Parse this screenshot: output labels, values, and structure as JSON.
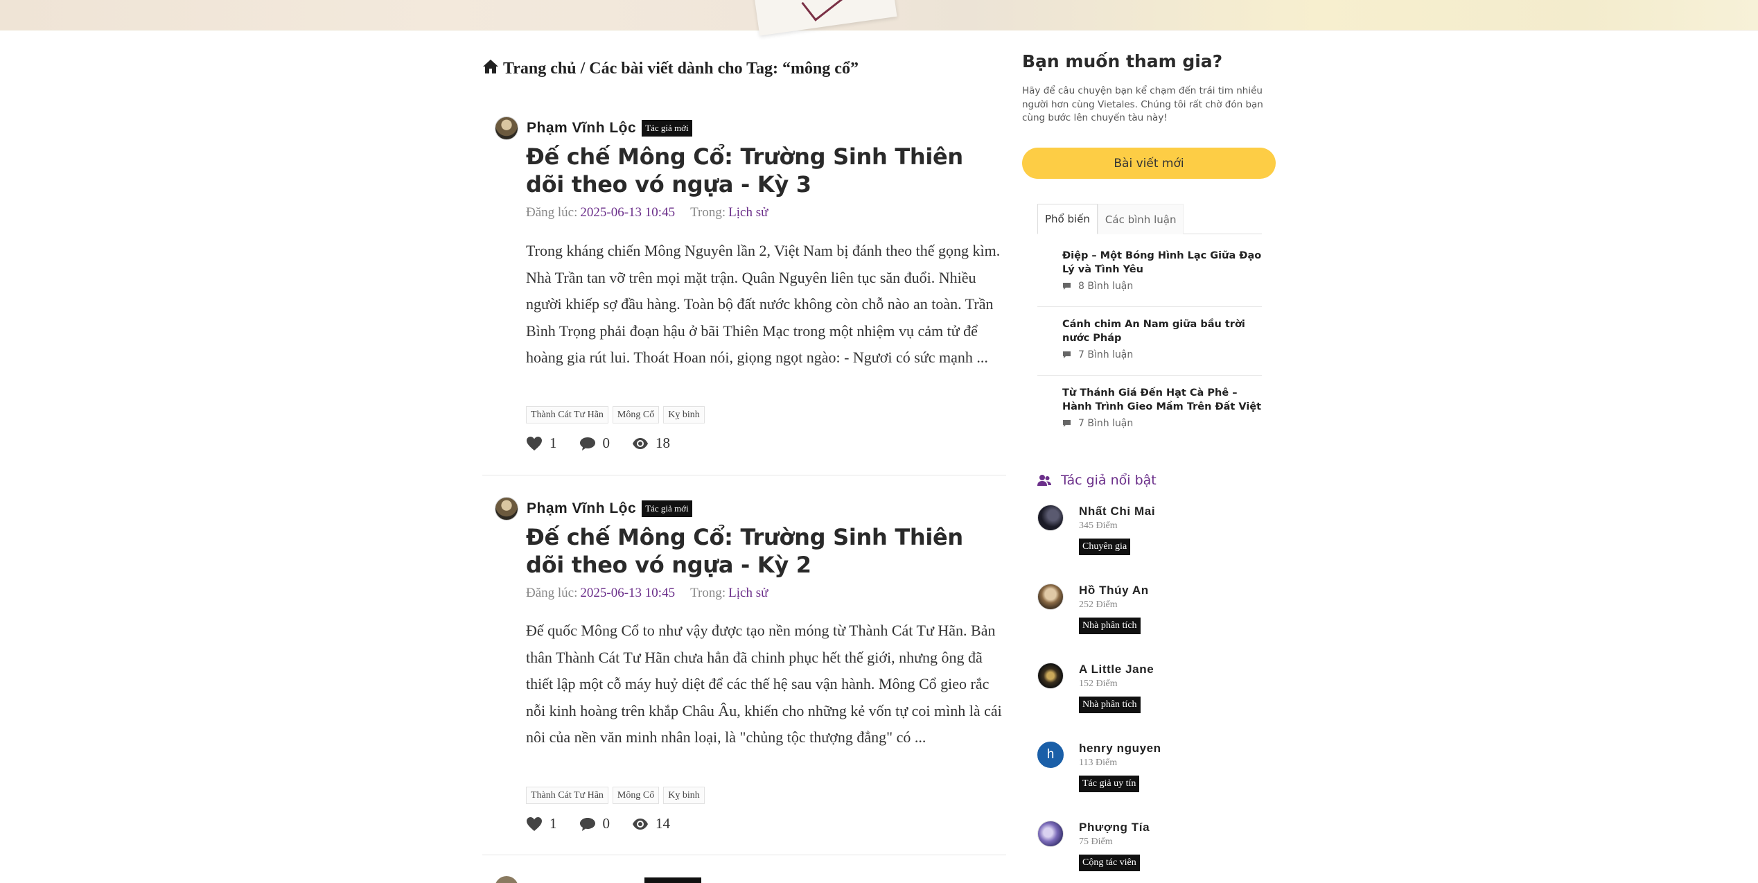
{
  "breadcrumb": {
    "home": "Trang chủ",
    "separator": "/",
    "current": "Các bài viết dành cho Tag: “mông cổ”"
  },
  "posts": [
    {
      "author": "Phạm Vĩnh Lộc",
      "author_badge": "Tác giả mới",
      "title": "Đế chế Mông Cổ: Trường Sinh Thiên dõi theo vó ngựa - Kỳ 3",
      "posted_label": "Đăng lúc:",
      "posted_at": "2025-06-13 10:45",
      "in_label": "Trong:",
      "category": "Lịch sử",
      "excerpt": "Trong kháng chiến Mông Nguyên lần 2, Việt Nam bị đánh theo thế gọng kìm. Nhà Trần tan vỡ trên mọi mặt trận. Quân Nguyên liên tục săn đuổi. Nhiều người khiếp sợ đầu hàng. Toàn bộ đất nước không còn chỗ nào an toàn. Trần Bình Trọng phải đoạn hậu ở bãi Thiên Mạc trong một nhiệm vụ cảm tử để hoàng gia rút lui. Thoát Hoan nói, giọng ngọt ngào: - Ngươi có sức mạnh ...",
      "tags": [
        "Thành Cát Tư Hãn",
        "Mông Cổ",
        "Kỵ binh"
      ],
      "likes": "1",
      "comments": "0",
      "views": "18"
    },
    {
      "author": "Phạm Vĩnh Lộc",
      "author_badge": "Tác giả mới",
      "title": "Đế chế Mông Cổ: Trường Sinh Thiên dõi theo vó ngựa - Kỳ 2",
      "posted_label": "Đăng lúc:",
      "posted_at": "2025-06-13 10:45",
      "in_label": "Trong:",
      "category": "Lịch sử",
      "excerpt": "Đế quốc Mông Cổ to như vậy được tạo nền móng từ Thành Cát Tư Hãn. Bản thân Thành Cát Tư Hãn chưa hẳn đã chinh phục hết thế giới, nhưng ông đã thiết lập một cỗ máy huỷ diệt để các thế hệ sau vận hành.  Mông Cổ gieo rắc nỗi kinh hoàng trên khắp Châu Âu, khiến cho những kẻ vốn tự coi mình là cái nôi của nền văn minh nhân loại, là \"chủng tộc thượng đẳng\" có ...",
      "tags": [
        "Thành Cát Tư Hãn",
        "Mông Cổ",
        "Kỵ binh"
      ],
      "likes": "1",
      "comments": "0",
      "views": "14"
    }
  ],
  "sidebar": {
    "join_title": "Bạn muốn tham gia?",
    "join_desc": "Hãy để câu chuyện bạn kể chạm đến trái tim nhiều người hơn cùng Vietales. Chúng tôi rất chờ đón bạn cùng bước lên chuyến tàu này!",
    "new_post_button": "Bài viết mới",
    "tabs": [
      "Phổ biến",
      "Các bình luận"
    ],
    "popular": [
      {
        "title": "Điệp – Một Bóng Hình Lạc Giữa Đạo Lý và Tình Yêu",
        "comments": "8 Bình luận"
      },
      {
        "title": "Cánh chim An Nam giữa bầu trời nước Pháp",
        "comments": "7 Bình luận"
      },
      {
        "title": "Từ Thánh Giá Đến Hạt Cà Phê – Hành Trình Gieo Mầm Trên Đất Việt",
        "comments": "7 Bình luận"
      }
    ],
    "featured_title": "Tác giả nổi bật",
    "featured": [
      {
        "name": "Nhất Chi Mai",
        "points": "345 Điểm",
        "badge": "Chuyên gia"
      },
      {
        "name": "Hồ Thúy An",
        "points": "252 Điểm",
        "badge": "Nhà phân tích"
      },
      {
        "name": "A Little Jane",
        "points": "152 Điểm",
        "badge": "Nhà phân tích"
      },
      {
        "name": "henry nguyen",
        "points": "113 Điểm",
        "badge": "Tác giả uy tín",
        "initial": "h"
      },
      {
        "name": "Phượng Tía",
        "points": "75 Điểm",
        "badge": "Cộng tác viên"
      }
    ]
  },
  "colors": {
    "accent_purple": "#6b2f8a",
    "button_yellow": "#fdcd45",
    "badge_black": "#111111",
    "henry_avatar": "#1a5fa8"
  },
  "icons": [
    "home-icon",
    "heart-icon",
    "comment-icon",
    "eye-icon",
    "users-icon"
  ]
}
